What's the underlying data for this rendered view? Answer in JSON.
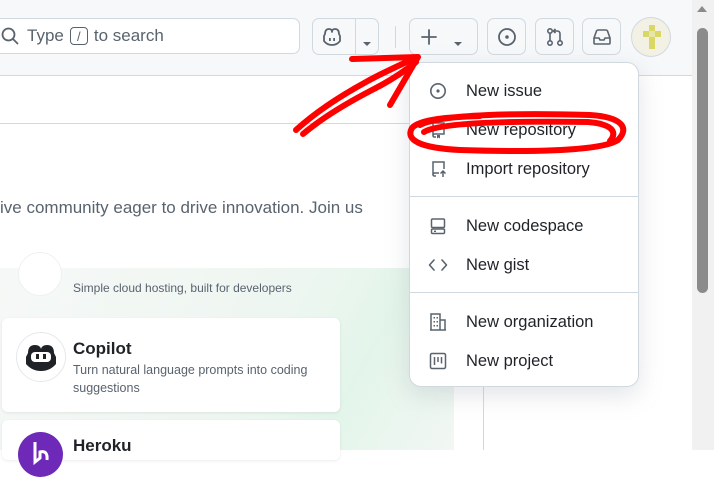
{
  "header": {
    "search_prefix": "Type",
    "search_key": "/",
    "search_suffix": "to search"
  },
  "page": {
    "promo_text": "ive community eager to drive innovation. Join us"
  },
  "cards": [
    {
      "title": "",
      "desc": "Simple cloud hosting, built for developers"
    },
    {
      "title": "Copilot",
      "desc": "Turn natural language prompts into coding suggestions"
    },
    {
      "title": "Heroku",
      "desc": ""
    }
  ],
  "menu": {
    "items": [
      {
        "label": "New issue",
        "icon": "issue-opened-icon"
      },
      {
        "label": "New repository",
        "icon": "repo-icon"
      },
      {
        "label": "Import repository",
        "icon": "repo-push-icon"
      },
      {
        "label": "New codespace",
        "icon": "codespace-icon"
      },
      {
        "label": "New gist",
        "icon": "code-icon"
      },
      {
        "label": "New organization",
        "icon": "organization-icon"
      },
      {
        "label": "New project",
        "icon": "project-icon"
      }
    ]
  },
  "colors": {
    "annotation": "#ff0000",
    "heroku": "#6f29b9"
  }
}
